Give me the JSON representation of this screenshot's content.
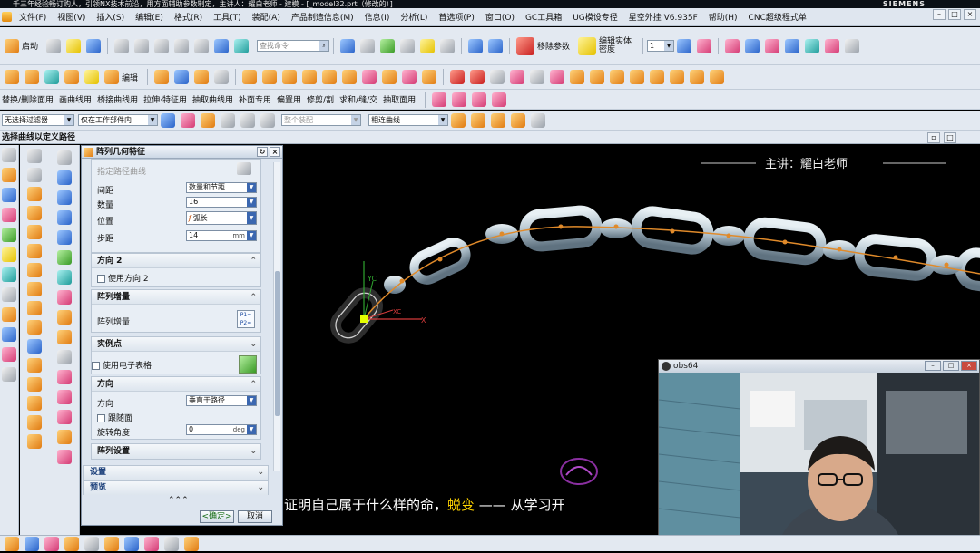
{
  "window": {
    "title": "千三年经验畅订购人，引领NX技术前沿，用方面辅助参数制定，主讲人：耀白老师 - 建模 - [_model32.prt（修改的）]",
    "brand": "SIEMENS"
  },
  "menu": [
    "文件(F)",
    "视图(V)",
    "插入(S)",
    "编辑(E)",
    "格式(R)",
    "工具(T)",
    "装配(A)",
    "产品制造信息(M)",
    "信息(I)",
    "分析(L)",
    "首选项(P)",
    "窗口(O)",
    "GC工具箱",
    "UG模设专径",
    "星空外挂 V6.935F",
    "帮助(H)",
    "CNC超级程式单"
  ],
  "toolbar1": {
    "start_label": "启动",
    "search_placeholder": "查找命令",
    "remove_params_label": "移除参数",
    "edit_solid_density_label": "编辑实体密度",
    "layer_value": "1"
  },
  "toolbar2": {
    "edit_label": "编辑"
  },
  "toolbar3": {
    "items": [
      "替换/删除面用",
      "画曲线用",
      "桥接曲线用",
      "拉伸·特征用",
      "抽取曲线用",
      "补面专用",
      "偏置用",
      "修剪/割",
      "求和/缝/交",
      "抽取面用"
    ]
  },
  "selection_bar": {
    "filter": "无选择过滤器",
    "scope": "仅在工作部件内",
    "assembly": "整个装配",
    "curve_rule": "相连曲线"
  },
  "cue_line": "选择曲线以定义路径",
  "dialog": {
    "title": "阵列几何特征",
    "specify_curve": "指定路径曲线",
    "spacing_label": "间距",
    "spacing_value": "数量和节距",
    "count_label": "数量",
    "count_value": "16",
    "position_label": "位置",
    "position_value": "弧长",
    "step_label": "步距",
    "step_value": "14",
    "step_unit": "mm",
    "direction2_header": "方向 2",
    "use_direction2": "使用方向 2",
    "pattern_increment_header": "阵列增量",
    "pattern_increment_label": "阵列增量",
    "instance_points_header": "实例点",
    "use_spreadsheet": "使用电子表格",
    "orientation_header": "方向",
    "orientation_label": "方向",
    "orientation_value": "垂直于路径",
    "follow_face": "跟随面",
    "rotation_angle_label": "旋转角度",
    "rotation_angle_value": "0",
    "rotation_angle_unit": "deg",
    "pattern_settings_header": "阵列设置",
    "settings_header": "设置",
    "preview_header": "预览",
    "ok_label": "<确定>",
    "cancel_label": "取消"
  },
  "viewport": {
    "teacher_caption": "主讲：耀白老师",
    "subtitle_prefix": "证明自己属于什么样的命，",
    "subtitle_highlight": "蜕变",
    "subtitle_suffix": " —— 从学习开",
    "axis_x": "X",
    "axis_y": "YC",
    "axis_xc": "XC",
    "chain_color": "#aebfca",
    "path_color": "#e08a2a"
  },
  "obs": {
    "title": "obs64"
  }
}
